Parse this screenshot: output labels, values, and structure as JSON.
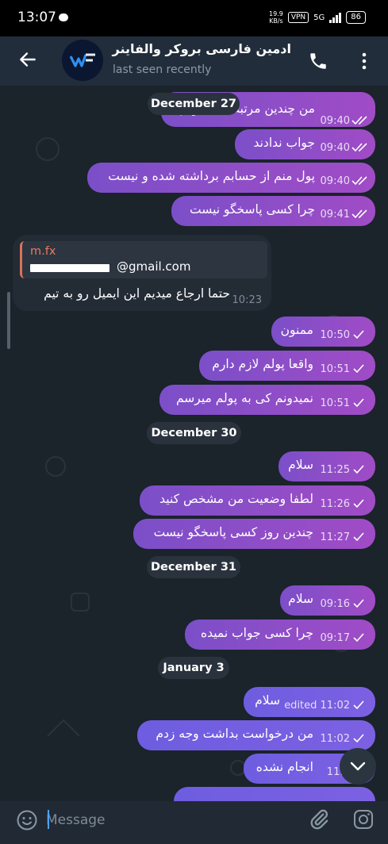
{
  "status_bar": {
    "time": "13:07",
    "net_speed_value": "19.9",
    "net_speed_unit": "KB/s",
    "vpn": "VPN",
    "network": "5G",
    "battery": "86"
  },
  "header": {
    "title": "ادمین فارسی بروکر والفاینر",
    "subtitle": "last seen recently",
    "avatar_text": "WF"
  },
  "messages": {
    "m1": {
      "text": "من چندین مرتبه ایمیل زدم",
      "time": "09:40"
    },
    "m2": {
      "text": "جواب ندادند",
      "time": "09:40"
    },
    "m3": {
      "text": "پول منم از حسابم برداشته شده و نیست",
      "time": "09:40"
    },
    "m4": {
      "text": "چرا کسی پاسخگو نیست",
      "time": "09:41"
    },
    "incoming": {
      "reply_name": "m.fx",
      "reply_email": "@gmail.com",
      "text": "حتما ارجاع میدیم این ایمیل رو به تیم",
      "time": "10:23"
    },
    "m5": {
      "text": "ممنون",
      "time": "10:50"
    },
    "m6": {
      "text": "واقعا پولم لازم دارم",
      "time": "10:51"
    },
    "m7": {
      "text": "نمیدونم کی به پولم میرسم",
      "time": "10:51"
    },
    "m8": {
      "text": "سلام",
      "time": "11:25"
    },
    "m9": {
      "text": "لطفا وضعیت من مشخص کنید",
      "time": "11:26"
    },
    "m10": {
      "text": "چندین روز کسی پاسخگو نیست",
      "time": "11:27"
    },
    "m11": {
      "text": "سلام",
      "time": "09:16"
    },
    "m12": {
      "text": "چرا کسی جواب نمیده",
      "time": "09:17"
    },
    "m13": {
      "text": "سلام",
      "time": "edited 11:02"
    },
    "m14": {
      "text": "من درخواست بداشت وجه زدم",
      "time": "11:02"
    },
    "m15": {
      "text": "انجام نشده",
      "time": "11:0"
    }
  },
  "dates": {
    "d1": "December 27",
    "d2": "December 30",
    "d3": "December 31",
    "d4": "January 3"
  },
  "composer": {
    "placeholder": "Message"
  },
  "colors": {
    "outgoing_bubble": "#8a4ec8",
    "incoming_bubble": "#232b35",
    "header": "#212d3b",
    "chat_background": "#1b232b"
  },
  "icons": {
    "back": "arrow-left",
    "call": "phone",
    "menu": "vertical-dots",
    "emoji": "smile",
    "attach": "paperclip",
    "camera": "instagram-camera",
    "scroll": "chevron-down"
  }
}
